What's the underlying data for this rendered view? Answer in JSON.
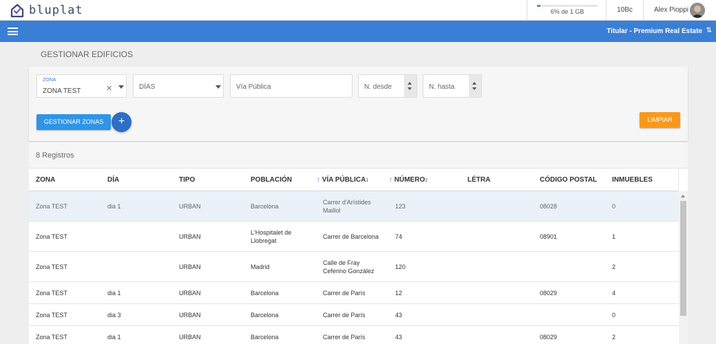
{
  "brand": {
    "name": "bluplat"
  },
  "header": {
    "storage_text": "6% de 1 GB",
    "storage_fraction": 0.06,
    "credits": "10Bc",
    "user_name": "Alex Pioppi"
  },
  "nav": {
    "account_label": "Titular - Premium Real Estate"
  },
  "page": {
    "title": "GESTIONAR EDIFICIOS"
  },
  "filters": {
    "zona_label": "ZONA",
    "zona_value": "ZONA TEST",
    "dias_placeholder": "DÍAS",
    "via_placeholder": "Vía Pública",
    "num_desde_placeholder": "N. desde",
    "num_hasta_placeholder": "N. hasta",
    "gestionar_zonas_label": "GESTIONAR ZONAS",
    "add_label": "+",
    "limpiar_label": "LIMPIAR"
  },
  "table": {
    "records_label": "8 Registros",
    "columns": [
      {
        "label": "ZONA"
      },
      {
        "label": "DÍA"
      },
      {
        "label": "TIPO"
      },
      {
        "label": "POBLACIÓN"
      },
      {
        "label": "VÍA PÚBLICA",
        "sort_arrow": "↑",
        "sort_index": "1"
      },
      {
        "label": "NÚMERO",
        "sort_arrow": "↑",
        "sort_index": "2"
      },
      {
        "label": "LÉTRA"
      },
      {
        "label": "CÓDIGO POSTAL"
      },
      {
        "label": "INMUEBLES"
      }
    ],
    "rows": [
      {
        "zona": "Zona TEST",
        "dia": "dia 1",
        "tipo": "URBAN",
        "poblacion": "Barcelona",
        "via": "Carrer d'Arístides Maillol",
        "numero": "123",
        "letra": "",
        "cp": "08028",
        "inmuebles": "0"
      },
      {
        "zona": "Zona TEST",
        "dia": "",
        "tipo": "URBAN",
        "poblacion": "L'Hospitalet de Llobregat",
        "via": "Carrer de Barcelona",
        "numero": "74",
        "letra": "",
        "cp": "08901",
        "inmuebles": "1"
      },
      {
        "zona": "Zona TEST",
        "dia": "",
        "tipo": "URBAN",
        "poblacion": "Madrid",
        "via": "Calle de Fray Ceferino González",
        "numero": "120",
        "letra": "",
        "cp": "",
        "inmuebles": "2"
      },
      {
        "zona": "Zona TEST",
        "dia": "dia 1",
        "tipo": "URBAN",
        "poblacion": "Barcelona",
        "via": "Carrer de París",
        "numero": "12",
        "letra": "",
        "cp": "08029",
        "inmuebles": "4"
      },
      {
        "zona": "Zona TEST",
        "dia": "dia 3",
        "tipo": "URBAN",
        "poblacion": "Barcelona",
        "via": "Carrer de París",
        "numero": "43",
        "letra": "",
        "cp": "",
        "inmuebles": "0"
      },
      {
        "zona": "Zona TEST",
        "dia": "dia 1",
        "tipo": "URBAN",
        "poblacion": "Barcelona",
        "via": "Carrer de París",
        "numero": "43",
        "letra": "",
        "cp": "08029",
        "inmuebles": "2"
      }
    ]
  }
}
